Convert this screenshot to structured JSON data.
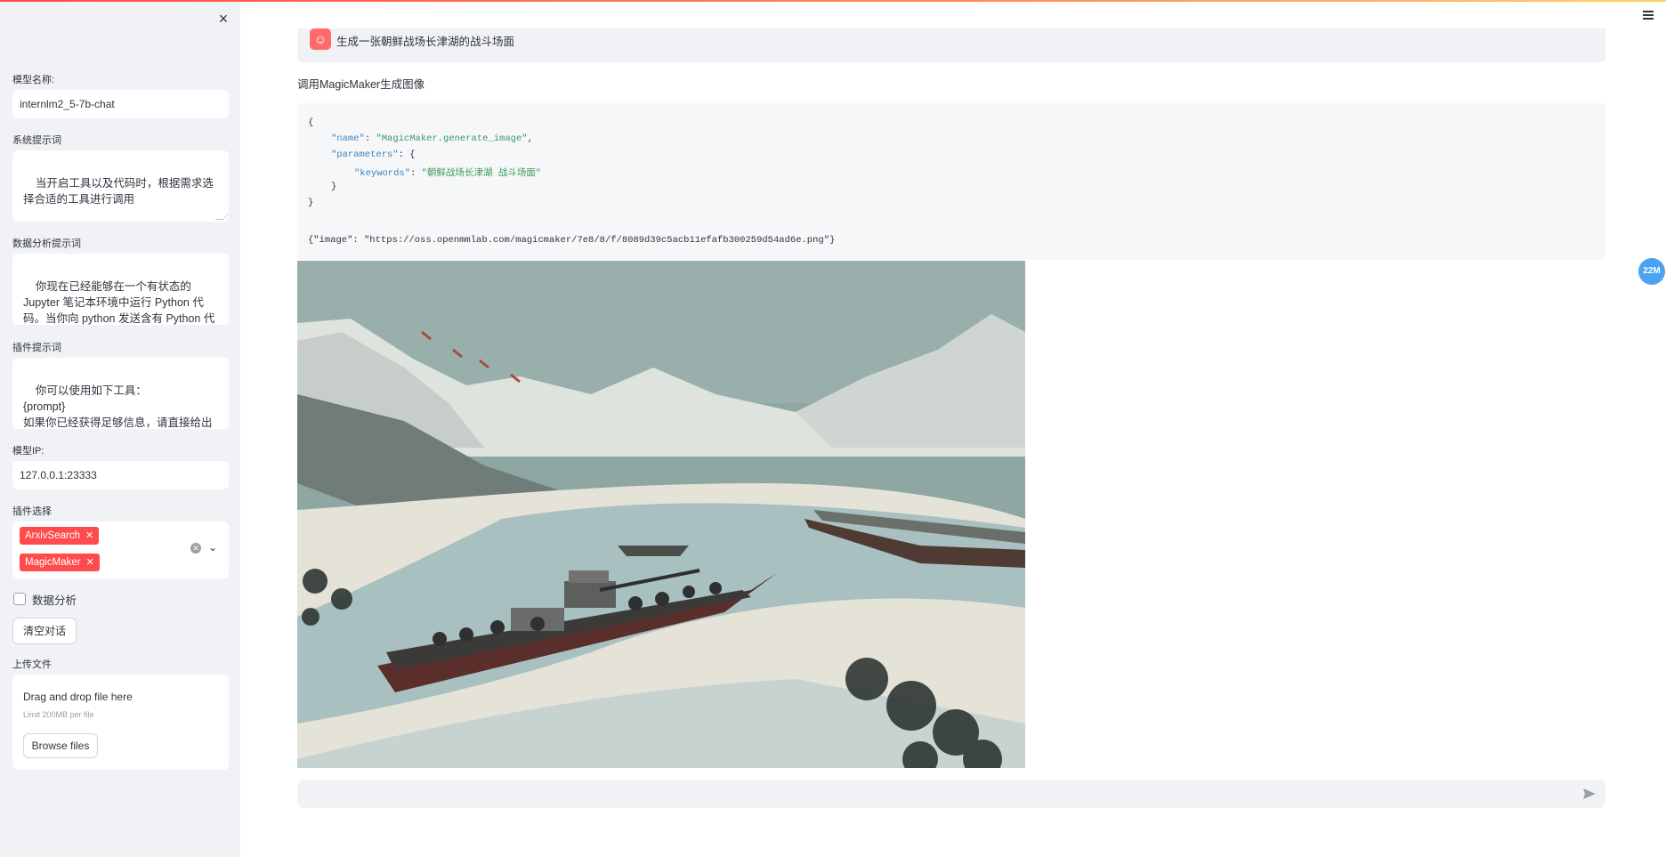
{
  "sidebar": {
    "model_name_label": "模型名称:",
    "model_name_value": "internlm2_5-7b-chat",
    "system_prompt_label": "系统提示词",
    "system_prompt_value": "当开启工具以及代码时，根据需求选择合适的工具进行调用",
    "data_analysis_prompt_label": "数据分析提示词",
    "data_analysis_prompt_value": "你现在已经能够在一个有状态的 Jupyter 笔记本环境中运行 Python 代码。当你向 python 发送含有 Python 代码的消息时，它将在该环境中执",
    "plugin_prompt_label": "插件提示词",
    "plugin_prompt_value": "你可以使用如下工具：\n{prompt}\n如果你已经获得足够信息，请直接给出答案. 避免不必要的工具调用! 同时",
    "model_ip_label": "模型IP:",
    "model_ip_value": "127.0.0.1:23333",
    "plugin_select_label": "插件选择",
    "plugins": [
      "ArxivSearch",
      "MagicMaker"
    ],
    "data_analysis_checkbox_label": "数据分析",
    "data_analysis_checked": false,
    "clear_chat_button": "清空对话",
    "upload_label": "上传文件",
    "upload_dropzone_text": "Drag and drop file here",
    "upload_limit_text": "Limit 200MB per file",
    "browse_button": "Browse files",
    "close_glyph": "×"
  },
  "chat": {
    "user_message": "生成一张朝鲜战场长津湖的战斗场面",
    "assistant_intro": "调用MagicMaker生成图像",
    "code": {
      "open_brace": "{",
      "name_key": "\"name\"",
      "name_value": "\"MagicMaker.generate_image\"",
      "params_key": "\"parameters\"",
      "keywords_key": "\"keywords\"",
      "keywords_value": "\"朝鲜战场长津湖 战斗场面\"",
      "inner_close": "}",
      "close_brace": "}",
      "result": "{\"image\": \"https://oss.openmmlab.com/magicmaker/7e8/8/f/8089d39c5acb11efafb300259d54ad6e.png\"}"
    },
    "input_placeholder": ""
  },
  "badge_text": "22M",
  "colors": {
    "accent": "#ff4b4b",
    "sidebar_bg": "#f0f2f6",
    "badge": "#4aa3f0"
  },
  "icons": [
    "close-icon",
    "hamburger-menu-icon",
    "chevron-down-icon",
    "clear-icon",
    "send-icon",
    "bot-avatar-icon"
  ]
}
